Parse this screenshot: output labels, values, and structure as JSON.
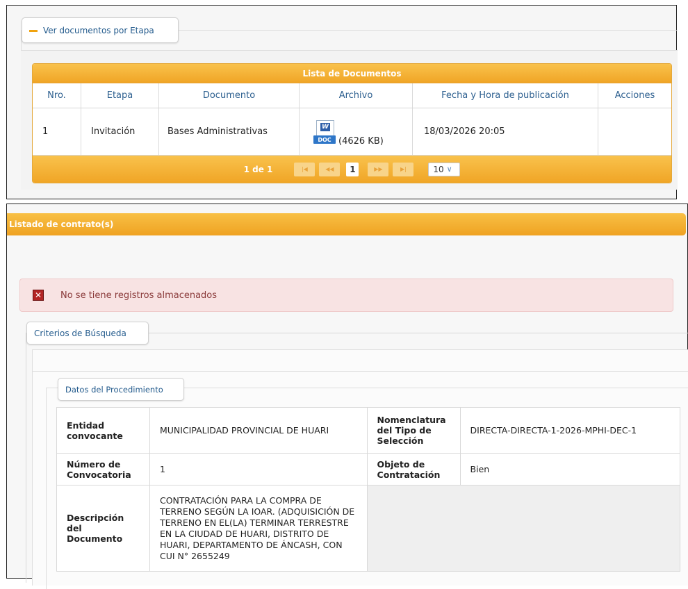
{
  "doc_panel": {
    "legend": "Ver documentos por Etapa",
    "table_title": "Lista de Documentos",
    "columns": [
      "Nro.",
      "Etapa",
      "Documento",
      "Archivo",
      "Fecha y Hora de publicación",
      "Acciones"
    ],
    "row": {
      "nro": "1",
      "etapa": "Invitación",
      "documento": "Bases Administrativas",
      "file_icon": "word-doc-icon",
      "file_badge": "DOC",
      "file_size": "(4626 KB)",
      "fecha": "18/03/2026 20:05",
      "acciones": ""
    },
    "pager": {
      "info": "1 de 1",
      "current_page": "1",
      "page_size": "10"
    }
  },
  "contracts": {
    "title": "Listado de contrato(s)",
    "alert_text": "No se tiene registros almacenados",
    "alert_icon": "error-x-icon"
  },
  "criteria": {
    "legend": "Criterios de Búsqueda",
    "datos_legend": "Datos del Procedimiento",
    "fields": {
      "entidad_label": "Entidad convocante",
      "entidad_value": "MUNICIPALIDAD PROVINCIAL DE HUARI",
      "nomenclatura_label": "Nomenclatura del Tipo de Selección",
      "nomenclatura_value": "DIRECTA-DIRECTA-1-2026-MPHI-DEC-1",
      "numero_label": "Número de Convocatoria",
      "numero_value": "1",
      "objeto_label": "Objeto de Contratación",
      "objeto_value": "Bien",
      "descripcion_label": "Descripción del Documento",
      "descripcion_value": "CONTRATACIÓN PARA LA COMPRA DE TERRENO SEGÚN LA IOAR. (ADQUISICIÓN DE TERRENO EN EL(LA) TERMINAR TERRESTRE EN LA CIUDAD DE HUARI, DISTRITO DE HUARI, DEPARTAMENTO DE ÁNCASH, CON CUI N° 2655249"
    }
  },
  "colors": {
    "accent_orange": "#f0a526",
    "link_blue": "#225a8c",
    "alert_bg": "#f8e3e3",
    "alert_icon_red": "#b32424"
  }
}
